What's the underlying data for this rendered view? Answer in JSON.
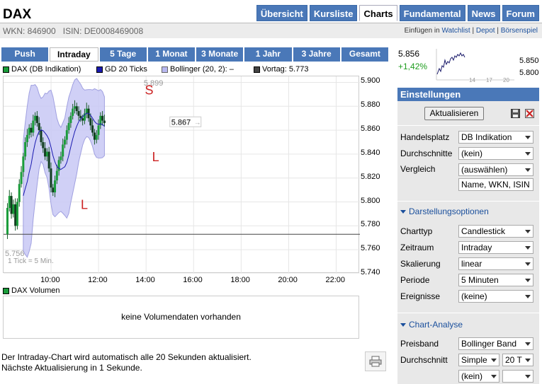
{
  "header": {
    "title": "DAX",
    "wkn": "WKN: 846900",
    "isin": "ISIN: DE0008469008",
    "links": {
      "prefix": "Einfügen in",
      "watchlist": "Watchlist",
      "sep1": "|",
      "depot": "Depot",
      "sep2": "|",
      "boersenspiel": "Börsenspiel"
    }
  },
  "nav": {
    "tabs": [
      "Übersicht",
      "Kursliste",
      "Charts",
      "Fundamental",
      "News",
      "Forum"
    ],
    "active": "Charts"
  },
  "period_tabs": [
    "Push",
    "Intraday",
    "5 Tage",
    "1 Monat",
    "3 Monate",
    "1 Jahr",
    "3 Jahre",
    "Gesamt"
  ],
  "legend": {
    "dax": "DAX (DB Indikation)",
    "gd": "GD 20 Ticks",
    "bollinger": "Bollinger (20, 2):",
    "bollinger_value": "–",
    "vortag": "Vortag: 5.773"
  },
  "chart_data": {
    "type": "candlestick",
    "x_ticks": [
      "10:00",
      "12:00",
      "14:00",
      "16:00",
      "18:00",
      "20:00",
      "22:00"
    ],
    "y_ticks": [
      "5.900",
      "5.880",
      "5.860",
      "5.840",
      "5.820",
      "5.800",
      "5.780",
      "5.760",
      "5.740"
    ],
    "ylim": [
      5740,
      5905
    ],
    "high_label": "5.899",
    "low_label": "5.756",
    "last_label": "5.867",
    "tick_note": "1 Tick = 5 Min.",
    "vortag": 5773,
    "markers": [
      {
        "label": "S"
      },
      {
        "label": "L"
      },
      {
        "label": "L"
      }
    ]
  },
  "volume": {
    "label": "DAX Volumen",
    "empty_text": "keine Volumendaten vorhanden"
  },
  "footnote": {
    "line1": "Der Intraday-Chart wird automatisch alle 20 Sekunden aktualisiert.",
    "line2": "Nächste Aktualisierung in 1 Sekunde."
  },
  "mini": {
    "price": "5.856",
    "change": "+1,42%",
    "y_labels": [
      "5.850",
      "5.800"
    ],
    "x_labels": [
      "14",
      "17",
      "20"
    ]
  },
  "settings": {
    "header": "Einstellungen",
    "update_button": "Aktualisieren",
    "handelsplatz": {
      "label": "Handelsplatz",
      "value": "DB Indikation"
    },
    "durchschnitte": {
      "label": "Durchschnitte",
      "value": "(kein)"
    },
    "vergleich": {
      "label": "Vergleich",
      "value": "(auswählen)",
      "input_value": "Name, WKN, ISIN"
    },
    "darstellung_header": "Darstellungsoptionen",
    "charttyp": {
      "label": "Charttyp",
      "value": "Candlestick"
    },
    "zeitraum": {
      "label": "Zeitraum",
      "value": "Intraday"
    },
    "skalierung": {
      "label": "Skalierung",
      "value": "linear"
    },
    "periode": {
      "label": "Periode",
      "value": "5 Minuten"
    },
    "ereignisse": {
      "label": "Ereignisse",
      "value": "(keine)"
    },
    "analyse_header": "Chart-Analyse",
    "preisband": {
      "label": "Preisband",
      "value": "Bollinger Band"
    },
    "durchschnitt": {
      "label": "Durchschnitt",
      "type_value": "Simple",
      "period_value": "20 T"
    },
    "extra": {
      "value": "(kein)",
      "value2": ""
    }
  },
  "colors": {
    "accent": "#4a78b8",
    "dax": "#1a9c3a",
    "gd": "#1a1ab0",
    "bollinger": "#b8b8f0",
    "vortag": "#444444",
    "marker": "#cc2222"
  }
}
